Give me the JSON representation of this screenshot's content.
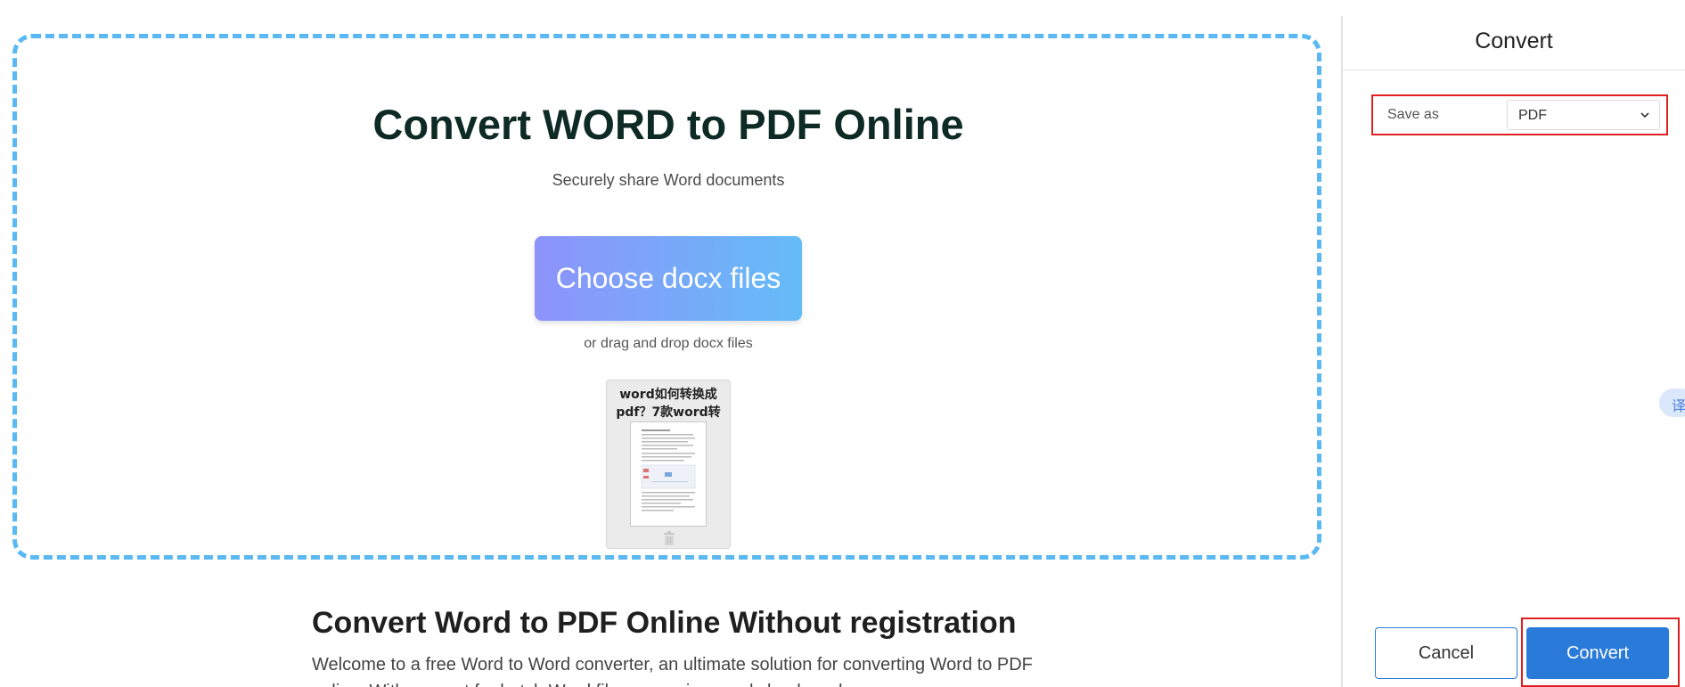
{
  "main": {
    "title": "Convert WORD to PDF Online",
    "subtitle": "Securely share Word documents",
    "choose_button": "Choose docx files",
    "drag_hint": "or drag and drop docx files",
    "file": {
      "name": "word如何转换成pdf？7款word转",
      "delete_icon": "trash-icon"
    }
  },
  "article": {
    "title": "Convert Word to PDF Online Without registration",
    "body": "Welcome to a free Word to Word converter, an ultimate solution for converting Word to PDF online. With support for batch Word file conversions and cloud-ready"
  },
  "panel": {
    "title": "Convert",
    "save_as_label": "Save as",
    "save_as_value": "PDF",
    "cancel_label": "Cancel",
    "convert_label": "Convert"
  },
  "translate_widget": {
    "label": "译"
  },
  "colors": {
    "dropzone_border": "#5ab8f2",
    "primary": "#2a7ad9",
    "highlight": "#e02020",
    "gradient_start": "#8d93fb",
    "gradient_end": "#64bcf7"
  }
}
